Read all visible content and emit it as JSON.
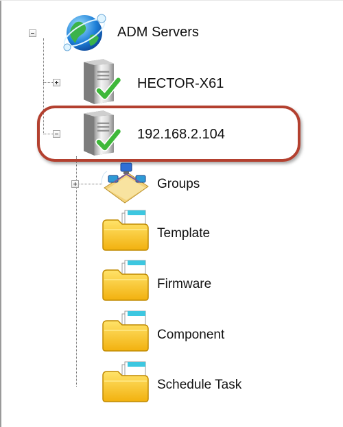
{
  "tree": {
    "root": {
      "label": "ADM Servers",
      "icon": "globe-network-icon",
      "expanded": true
    },
    "servers": [
      {
        "label": "HECTOR-X61",
        "icon": "server-online-icon",
        "status": "online",
        "expanded": false
      },
      {
        "label": "192.168.2.104",
        "icon": "server-online-icon",
        "status": "online",
        "expanded": true,
        "highlighted": true
      }
    ],
    "children": [
      {
        "label": "Groups",
        "icon": "groups-folder-icon",
        "expandable": true
      },
      {
        "label": "Template",
        "icon": "folder-icon"
      },
      {
        "label": "Firmware",
        "icon": "folder-icon"
      },
      {
        "label": "Component",
        "icon": "folder-icon"
      },
      {
        "label": "Schedule Task",
        "icon": "folder-icon"
      }
    ]
  },
  "colors": {
    "highlight": "#b3402f",
    "check": "#3fb83a",
    "folder": "#f6c21a",
    "globe": "#1d7fd8"
  }
}
